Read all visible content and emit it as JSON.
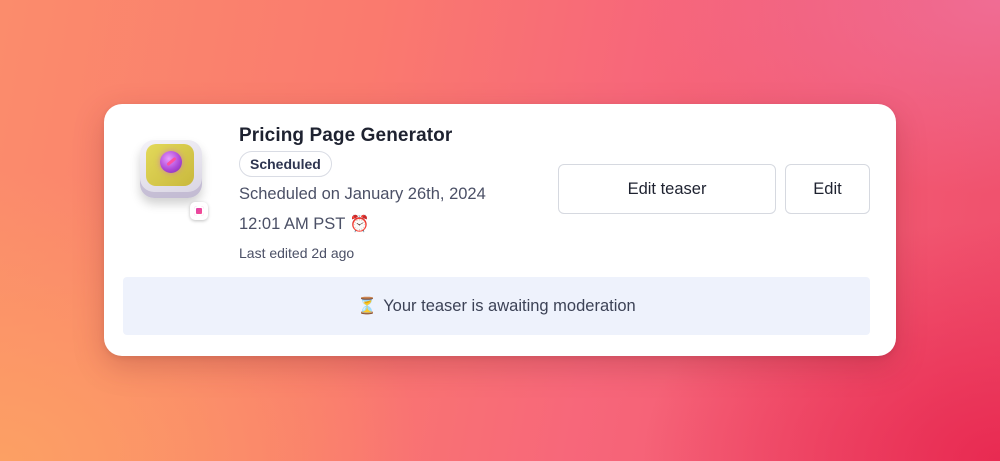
{
  "item": {
    "title": "Pricing Page Generator",
    "status": "Scheduled",
    "scheduled_text": "Scheduled on January 26th, 2024",
    "time_text": "12:01 AM PST",
    "time_icon": "⏰",
    "last_edited": "Last edited 2d ago"
  },
  "actions": {
    "edit_teaser_label": "Edit teaser",
    "edit_label": "Edit"
  },
  "notice": {
    "icon": "⏳",
    "text": "Your teaser is awaiting moderation"
  },
  "icons": {
    "app_icon": "app-icon",
    "badge_icon": "instagram-icon",
    "alarm_icon": "alarm-clock-icon",
    "hourglass_icon": "hourglass-icon"
  },
  "colors": {
    "card_bg": "#ffffff",
    "notice_bg": "#eef2fc",
    "title_text": "#1e2230",
    "body_text": "#4b5066"
  }
}
